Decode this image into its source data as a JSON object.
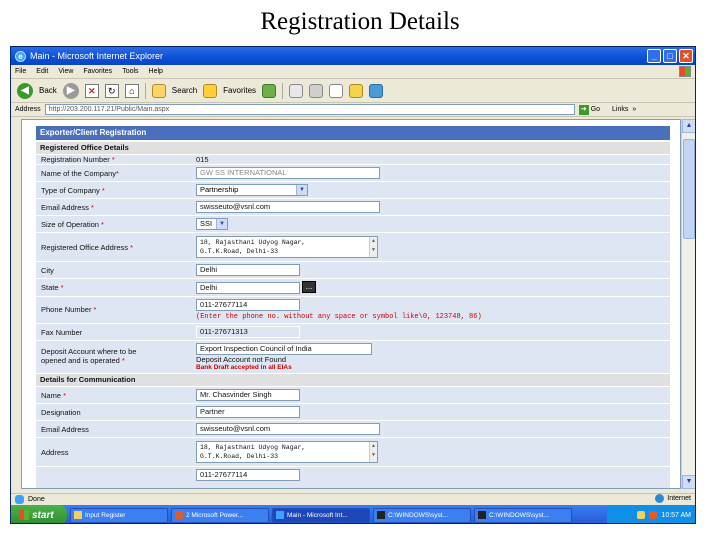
{
  "slide_title": "Registration Details",
  "window": {
    "title": "Main - Microsoft Internet Explorer",
    "menu": [
      "File",
      "Edit",
      "View",
      "Favorites",
      "Tools",
      "Help"
    ],
    "toolbar": {
      "back": "Back",
      "search": "Search",
      "favorites": "Favorites"
    },
    "address_label": "Address",
    "address_value": "http://203.200.117.21/Public/Main.aspx",
    "go": "Go",
    "links": "Links",
    "status": "Done",
    "zone": "Internet"
  },
  "form": {
    "header": "Exporter/Client Registration",
    "section_office": "Registered Office Details",
    "section_comm": "Details for Communication",
    "fields": {
      "registration_number": {
        "label": "Registration Number",
        "value": "015"
      },
      "company_name": {
        "label": "Name of the Company",
        "value": "GW SS INTERNATIONAL"
      },
      "company_type": {
        "label": "Type of Company",
        "value": "Partnership"
      },
      "email": {
        "label": "Email Address",
        "value": "swisseuto@vsnl.com"
      },
      "size": {
        "label": "Size of Operation",
        "value": "SSI"
      },
      "office_address": {
        "label": "Registered Office Address",
        "line1": "18, Rajasthani Udyog Nagar,",
        "line2": "G.T.K.Road, Delhi-33"
      },
      "city": {
        "label": "City",
        "value": "Delhi"
      },
      "state": {
        "label": "State",
        "value": "Delhi",
        "button": "..."
      },
      "phone": {
        "label": "Phone Number",
        "value": "011-27677114",
        "hint": "(Enter the phone no. without any space or symbol like\\0, 123748, 86)"
      },
      "fax": {
        "label": "Fax Number",
        "value": "011-27671313"
      },
      "deposit": {
        "label1": "Deposit Account where to be",
        "label2": "opened and is operated",
        "value": "Export Inspection Council of India",
        "note": "Deposit Account not Found",
        "warning": "Bank Draft accepted in all EIAs"
      },
      "contact_name": {
        "label": "Name",
        "value": "Mr. Chasvinder Singh"
      },
      "designation": {
        "label": "Designation",
        "value": "Partner"
      },
      "comm_email": {
        "label": "Email Address",
        "value": "swisseuto@vsnl.com"
      },
      "comm_address": {
        "label": "Address",
        "line1": "18, Rajasthani Udyog Nagar,",
        "line2": "G.T.K.Road, Delhi-33"
      },
      "comm_phone_partial": "011-27677114"
    }
  },
  "taskbar": {
    "start": "start",
    "tasks": [
      "Input Register",
      "2 Microsoft Power...",
      "Main - Microsoft Int...",
      "C:\\WINDOWS\\syst...",
      "C:\\WINDOWS\\syst..."
    ],
    "clock": "10:57 AM"
  },
  "colors": {
    "titlebar": "#0a50d6",
    "form_header": "#4a6fbc",
    "row_bg": "#dfe6f3",
    "required": "#cc0000",
    "taskbar": "#2459d6",
    "start": "#3a9a3a"
  }
}
